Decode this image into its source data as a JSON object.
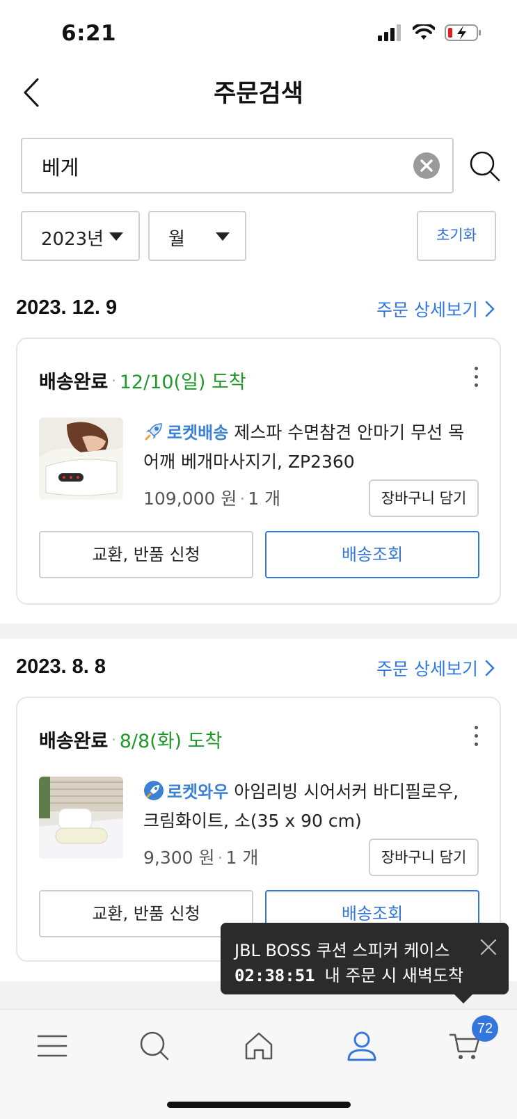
{
  "status_bar": {
    "time": "6:21"
  },
  "header": {
    "title": "주문검색"
  },
  "search": {
    "value": "베게",
    "placeholder": ""
  },
  "filters": {
    "year": "2023년",
    "month": "월",
    "reset": "초기화"
  },
  "orders": [
    {
      "date": "2023. 12. 9",
      "detail_link": "주문 상세보기",
      "status": "배송완료",
      "arrival": "12/10(일) 도착",
      "badge": "로켓배송",
      "product_title": "제스파 수면참견 안마기 무선 목어깨 베개마사지기, ZP2360",
      "price": "109,000 원",
      "quantity": "1 개",
      "cart_button": "장바구니 담기",
      "return_button": "교환, 반품 신청",
      "track_button": "배송조회"
    },
    {
      "date": "2023. 8. 8",
      "detail_link": "주문 상세보기",
      "status": "배송완료",
      "arrival": "8/8(화) 도착",
      "badge": "로켓와우",
      "product_title": "아임리빙 시어서커 바디필로우, 크림화이트, 소(35 x 90 cm)",
      "price": "9,300 원",
      "quantity": "1 개",
      "cart_button": "장바구니 담기",
      "return_button": "교환, 반품 신청",
      "track_button": "배송조회"
    }
  ],
  "toast": {
    "product": "JBL BOSS 쿠션 스피커 케이스",
    "timer": "02:38:51",
    "message": "내 주문 시 새벽도착"
  },
  "tab_bar": {
    "items": [
      "menu-icon",
      "search-icon",
      "home-icon",
      "my-page-icon",
      "cart-icon"
    ],
    "cart_count": "72",
    "active": "my-page-icon",
    "active_color": "#3477dc"
  }
}
